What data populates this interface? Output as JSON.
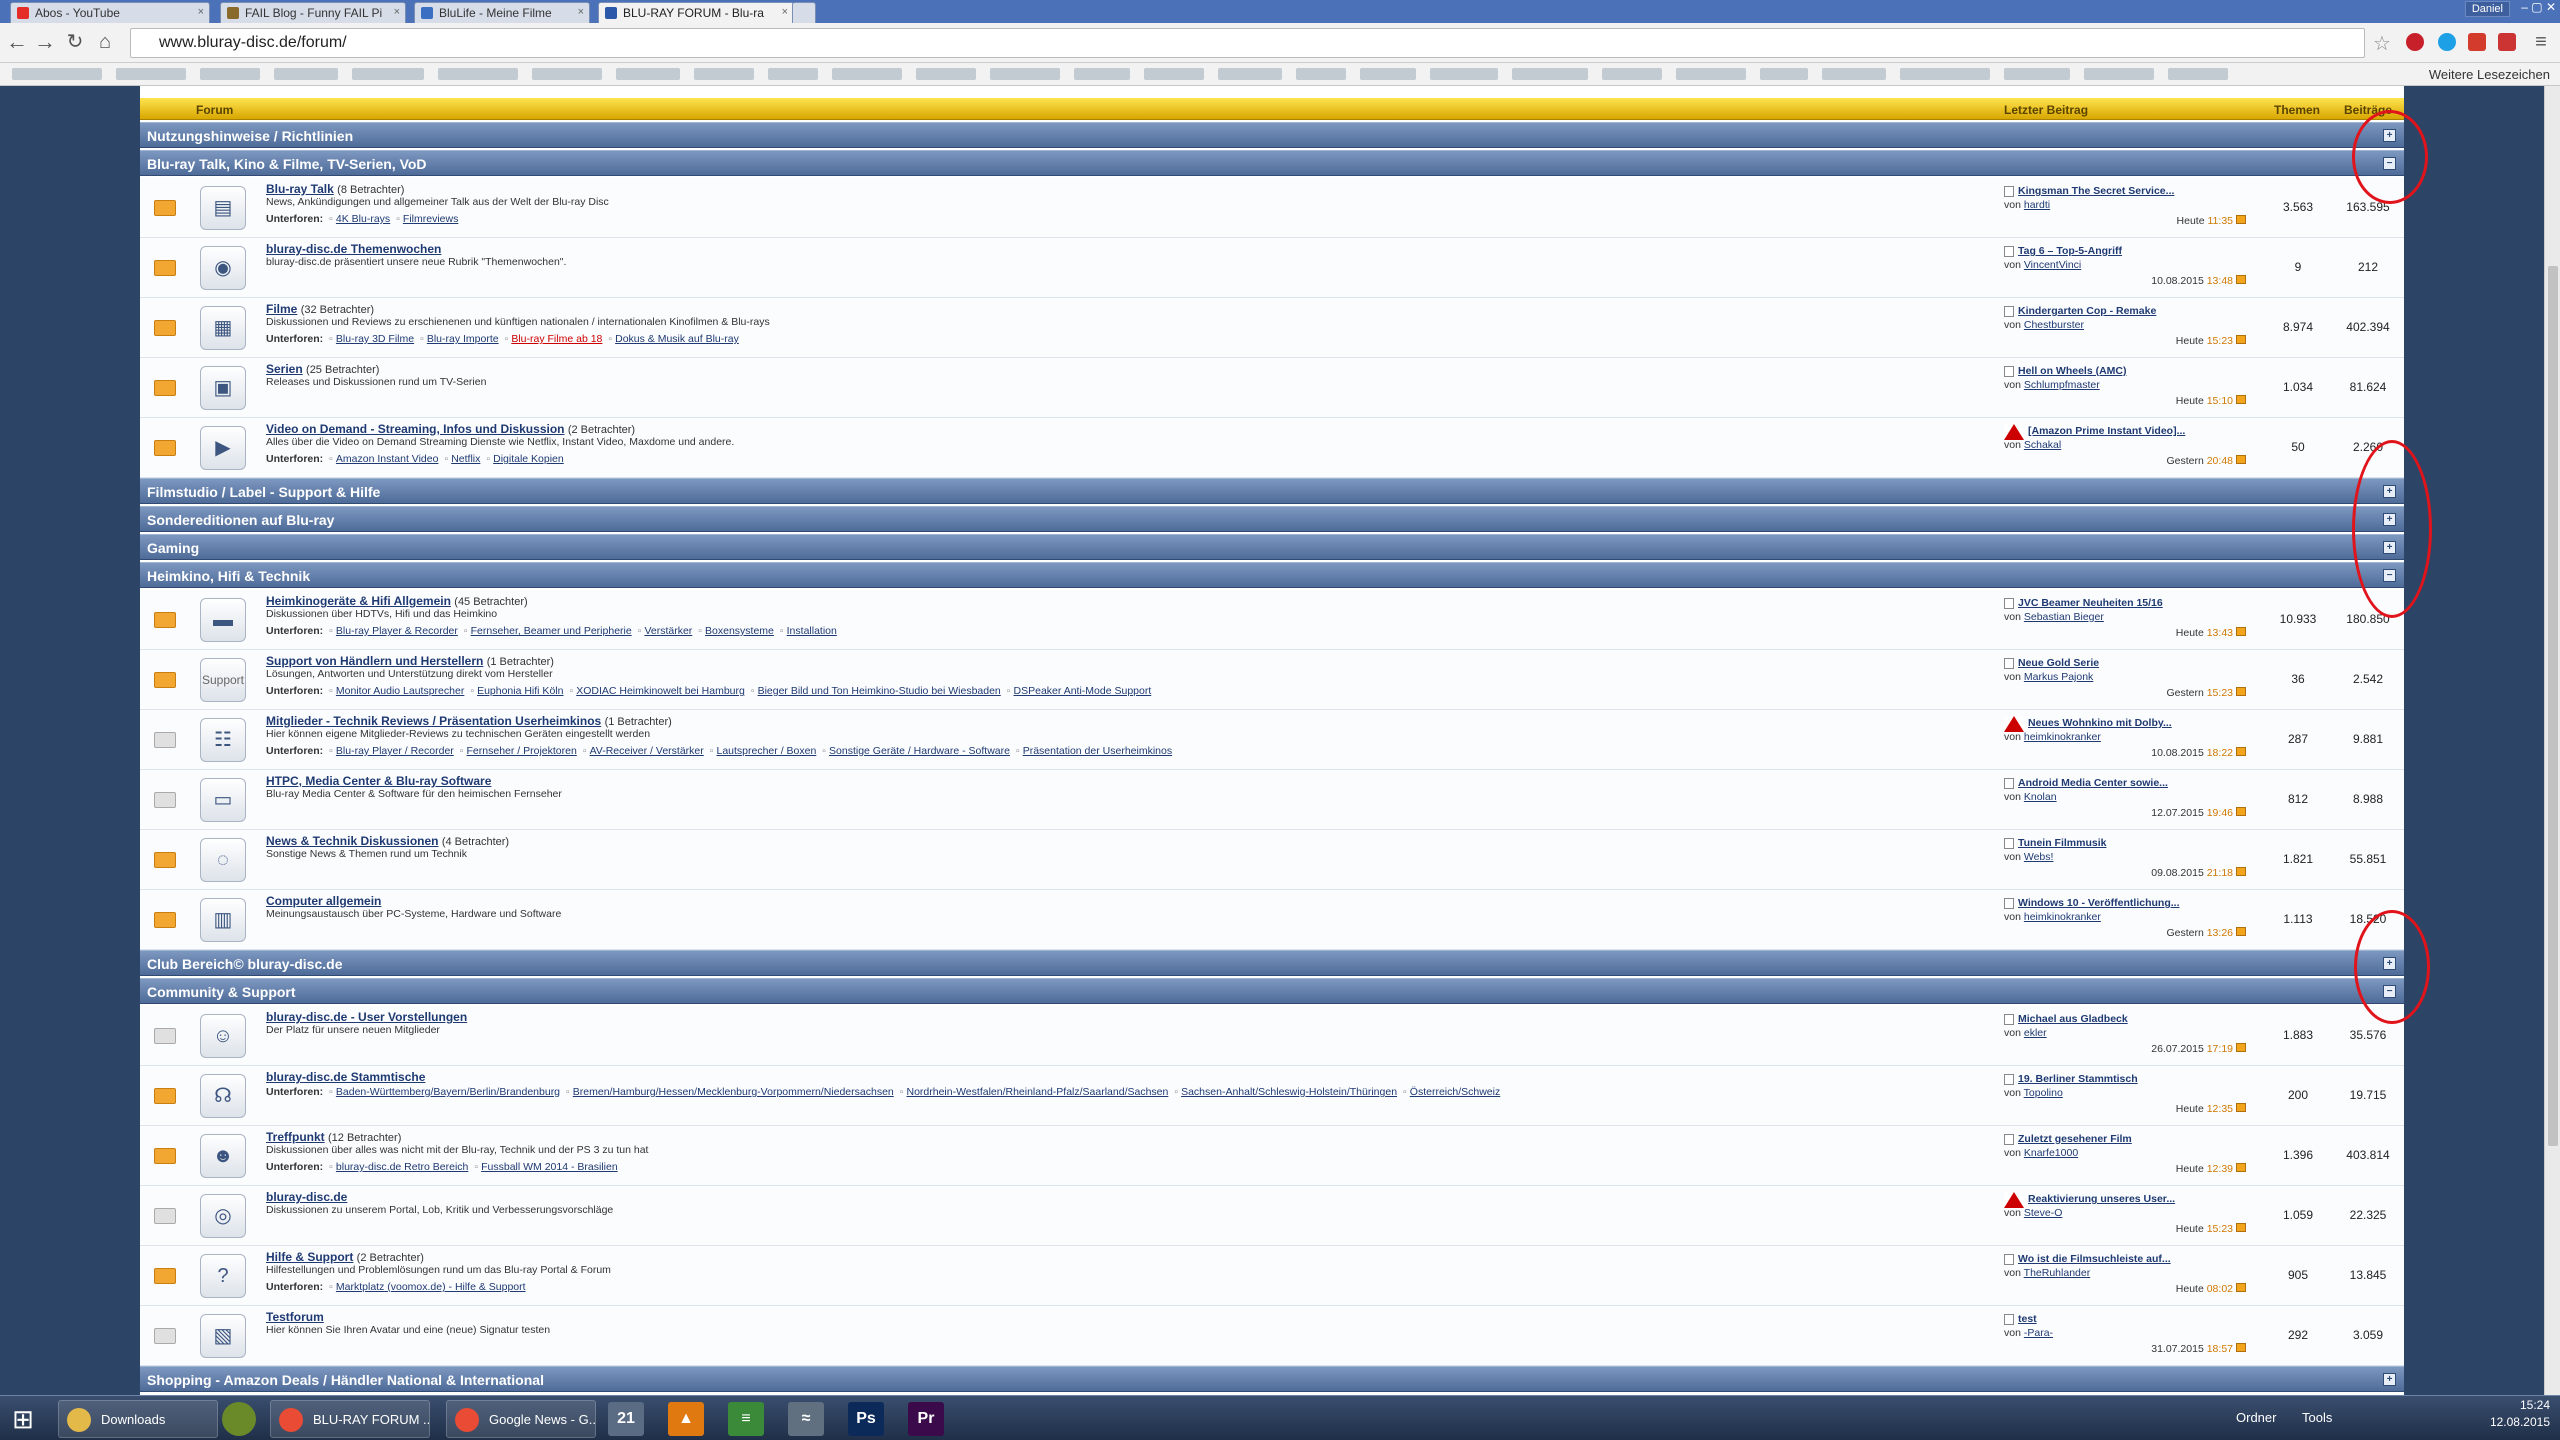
{
  "browser": {
    "tabs": [
      {
        "label": "Abos - YouTube",
        "color": "#e52d27"
      },
      {
        "label": "FAIL Blog - Funny FAIL Pi",
        "color": "#8a6a2b"
      },
      {
        "label": "BluLife - Meine Filme",
        "color": "#3a6fc2"
      },
      {
        "label": "BLU-RAY FORUM - Blu-ra",
        "color": "#2b58a8"
      }
    ],
    "user": "Daniel",
    "url": "www.bluray-disc.de/forum/",
    "more_bookmarks": "Weitere Lesezeichen"
  },
  "forum": {
    "header": {
      "forum": "Forum",
      "last": "Letzter Beitrag",
      "themen": "Themen",
      "beitraege": "Beiträge"
    },
    "sub_label": "Unterforen:",
    "categories": [
      {
        "title": "Nutzungshinweise / Richtlinien",
        "toggle": "+"
      },
      {
        "title": "Blu-ray Talk, Kino & Filme, TV-Serien, VoD",
        "toggle": "−"
      },
      {
        "title": "Filmstudio / Label - Support & Hilfe",
        "toggle": "+"
      },
      {
        "title": "Sondereditionen auf Blu-ray",
        "toggle": "+"
      },
      {
        "title": "Gaming",
        "toggle": "+"
      },
      {
        "title": "Heimkino, Hifi & Technik",
        "toggle": "−"
      },
      {
        "title": "Club Bereich© bluray-disc.de",
        "toggle": "+"
      },
      {
        "title": "Community & Support",
        "toggle": "−"
      },
      {
        "title": "Shopping - Amazon Deals / Händler National & International",
        "toggle": "+"
      }
    ],
    "rows": [
      {
        "title": "Blu-ray Talk",
        "views": "(8 Betrachter)",
        "desc": "News, Ankündigungen und allgemeiner Talk aus der Welt der Blu-ray Disc",
        "subs": [
          "4K Blu-rays",
          "Filmreviews"
        ],
        "last_title": "Kingsman The Secret Service...",
        "last_user": "hardti",
        "last_date": "Heute",
        "last_time": "11:35",
        "themen": "3.563",
        "beitraege": "163.595",
        "icon": "disc-stack-icon",
        "glyph": "▤",
        "warn": false
      },
      {
        "title": "bluray-disc.de Themenwochen",
        "views": "",
        "desc": "bluray-disc.de präsentiert unsere neue Rubrik \"Themenwochen\".",
        "subs": [],
        "last_title": "Tag 6 – Top-5-Angriff",
        "last_user": "VincentVinci",
        "last_date": "10.08.2015",
        "last_time": "13:48",
        "themen": "9",
        "beitraege": "212",
        "icon": "discs-icon",
        "glyph": "◉",
        "warn": false
      },
      {
        "title": "Filme",
        "views": "(32 Betrachter)",
        "desc": "Diskussionen und Reviews zu erschienenen und künftigen nationalen / internationalen Kinofilmen & Blu-rays",
        "subs": [
          "Blu-ray 3D Filme",
          "Blu-ray Importe",
          "Blu-ray Filme ab 18",
          "Dokus & Musik auf Blu-ray"
        ],
        "last_title": "Kindergarten Cop - Remake",
        "last_user": "Chestburster",
        "last_date": "Heute",
        "last_time": "15:23",
        "themen": "8.974",
        "beitraege": "402.394",
        "icon": "film-icon",
        "glyph": "▦",
        "warn": false
      },
      {
        "title": "Serien",
        "views": "(25 Betrachter)",
        "desc": "Releases und Diskussionen rund um TV-Serien",
        "subs": [],
        "last_title": "Hell on Wheels (AMC)",
        "last_user": "Schlumpfmaster",
        "last_date": "Heute",
        "last_time": "15:10",
        "themen": "1.034",
        "beitraege": "81.624",
        "icon": "tv-series-icon",
        "glyph": "▣",
        "warn": false
      },
      {
        "title": "Video on Demand - Streaming, Infos und Diskussion",
        "views": "(2 Betrachter)",
        "desc": "Alles über die Video on Demand Streaming Dienste wie Netflix, Instant Video, Maxdome und andere.",
        "subs": [
          "Amazon Instant Video",
          "Netflix",
          "Digitale Kopien"
        ],
        "last_title": "[Amazon Prime Instant Video]...",
        "last_user": "Schakal",
        "last_date": "Gestern",
        "last_time": "20:48",
        "themen": "50",
        "beitraege": "2.260",
        "icon": "video-on-demand-icon",
        "glyph": "▶",
        "warn": true
      },
      {
        "title": "Heimkinogeräte & Hifi Allgemein",
        "views": "(45 Betrachter)",
        "desc": "Diskussionen über HDTVs, Hifi und das Heimkino",
        "subs": [
          "Blu-ray Player & Recorder",
          "Fernseher, Beamer und Peripherie",
          "Verstärker",
          "Boxensysteme",
          "Installation"
        ],
        "last_title": "JVC Beamer Neuheiten 15/16",
        "last_user": "Sebastian Bieger",
        "last_date": "Heute",
        "last_time": "13:43",
        "themen": "10.933",
        "beitraege": "180.850",
        "icon": "tv-icon",
        "glyph": "▬",
        "warn": false
      },
      {
        "title": "Support von Händlern und Herstellern",
        "views": "(1 Betrachter)",
        "desc": "Lösungen, Antworten und Unterstützung direkt vom Hersteller",
        "subs": [
          "Monitor Audio Lautsprecher",
          "Euphonia Hifi Köln",
          "XODIAC Heimkinowelt bei Hamburg",
          "Bieger Bild und Ton Heimkino-Studio bei Wiesbaden",
          "DSPeaker Anti-Mode Support"
        ],
        "last_title": "Neue Gold Serie",
        "last_user": "Markus Pajonk",
        "last_date": "Gestern",
        "last_time": "15:23",
        "themen": "36",
        "beitraege": "2.542",
        "icon": "support-icon",
        "glyph": "Support",
        "warn": false
      },
      {
        "title": "Mitglieder - Technik Reviews / Präsentation Userheimkinos",
        "views": "(1 Betrachter)",
        "desc": "Hier können eigene Mitglieder-Reviews zu technischen Geräten eingestellt werden",
        "subs": [
          "Blu-ray Player / Recorder",
          "Fernseher / Projektoren",
          "AV-Receiver / Verstärker",
          "Lautsprecher / Boxen",
          "Sonstige Geräte / Hardware - Software",
          "Präsentation der Userheimkinos"
        ],
        "last_title": "Neues Wohnkino mit Dolby...",
        "last_user": "heimkinokranker",
        "last_date": "10.08.2015",
        "last_time": "18:22",
        "themen": "287",
        "beitraege": "9.881",
        "icon": "technik-reviews-icon",
        "glyph": "☷",
        "warn": true
      },
      {
        "title": "HTPC, Media Center & Blu-ray Software",
        "views": "",
        "desc": "Blu-ray Media Center & Software für den heimischen Fernseher",
        "subs": [],
        "last_title": "Android Media Center sowie...",
        "last_user": "Knolan",
        "last_date": "12.07.2015",
        "last_time": "19:46",
        "themen": "812",
        "beitraege": "8.988",
        "icon": "htpc-icon",
        "glyph": "▭",
        "warn": false
      },
      {
        "title": "News & Technik Diskussionen",
        "views": "(4 Betrachter)",
        "desc": "Sonstige News & Themen rund um Technik",
        "subs": [],
        "last_title": "Tunein Filmmusik",
        "last_user": "Webs!",
        "last_date": "09.08.2015",
        "last_time": "21:18",
        "themen": "1.821",
        "beitraege": "55.851",
        "icon": "speech-bubble-icon",
        "glyph": "◌",
        "warn": false
      },
      {
        "title": "Computer allgemein",
        "views": "",
        "desc": "Meinungsaustausch über PC-Systeme, Hardware und Software",
        "subs": [],
        "last_title": "Windows 10 - Veröffentlichung...",
        "last_user": "heimkinokranker",
        "last_date": "Gestern",
        "last_time": "13:26",
        "themen": "1.113",
        "beitraege": "18.520",
        "icon": "computer-icon",
        "glyph": "▥",
        "warn": false
      },
      {
        "title": "bluray-disc.de - User Vorstellungen",
        "views": "",
        "desc": "Der Platz für unsere neuen Mitglieder",
        "subs": [],
        "last_title": "Michael aus Gladbeck",
        "last_user": "ekler",
        "last_date": "26.07.2015",
        "last_time": "17:19",
        "themen": "1.883",
        "beitraege": "35.576",
        "icon": "user-icon",
        "glyph": "☺",
        "warn": false
      },
      {
        "title": "bluray-disc.de Stammtische",
        "views": "",
        "desc": "",
        "subs": [
          "Baden-Württemberg/Bayern/Berlin/Brandenburg",
          "Bremen/Hamburg/Hessen/Mecklenburg-Vorpommern/Niedersachsen",
          "Nordrhein-Westfalen/Rheinland-Pfalz/Saarland/Sachsen",
          "Sachsen-Anhalt/Schleswig-Holstein/Thüringen",
          "Österreich/Schweiz"
        ],
        "last_title": "19. Berliner Stammtisch",
        "last_user": "Topolino",
        "last_date": "Heute",
        "last_time": "12:35",
        "themen": "200",
        "beitraege": "19.715",
        "icon": "stammtisch-icon",
        "glyph": "☊",
        "warn": false
      },
      {
        "title": "Treffpunkt",
        "views": "(12 Betrachter)",
        "desc": "Diskussionen über alles was nicht mit der Blu-ray, Technik und der PS 3 zu tun hat",
        "subs": [
          "bluray-disc.de Retro Bereich",
          "Fussball WM 2014 - Brasilien"
        ],
        "last_title": "Zuletzt gesehener Film",
        "last_user": "Knarfe1000",
        "last_date": "Heute",
        "last_time": "12:39",
        "themen": "1.396",
        "beitraege": "403.814",
        "icon": "treffpunkt-icon",
        "glyph": "☻",
        "warn": false
      },
      {
        "title": "bluray-disc.de",
        "views": "",
        "desc": "Diskussionen zu unserem Portal, Lob, Kritik und Verbesserungsvorschläge",
        "subs": [],
        "last_title": "Reaktivierung unseres User...",
        "last_user": "Steve-O",
        "last_date": "Heute",
        "last_time": "15:23",
        "themen": "1.059",
        "beitraege": "22.325",
        "icon": "bluray-disc-logo-icon",
        "glyph": "◎",
        "warn": true
      },
      {
        "title": "Hilfe & Support",
        "views": "(2 Betrachter)",
        "desc": "Hilfestellungen und Problemlösungen rund um das Blu-ray Portal & Forum",
        "subs": [
          "Marktplatz (voomox.de) - Hilfe & Support"
        ],
        "last_title": "Wo ist die Filmsuchleiste auf...",
        "last_user": "TheRuhlander",
        "last_date": "Heute",
        "last_time": "08:02",
        "themen": "905",
        "beitraege": "13.845",
        "icon": "help-icon",
        "glyph": "?",
        "warn": false
      },
      {
        "title": "Testforum",
        "views": "",
        "desc": "Hier können Sie Ihren Avatar und eine (neue) Signatur testen",
        "subs": [],
        "last_title": "test",
        "last_user": "-Para-",
        "last_date": "31.07.2015",
        "last_time": "18:57",
        "themen": "292",
        "beitraege": "3.059",
        "icon": "test-icon",
        "glyph": "▧",
        "warn": false
      }
    ],
    "by_label": "von"
  },
  "taskbar": {
    "items": [
      {
        "label": "Downloads",
        "color": "#e3b94a"
      },
      {
        "label": "BLU-RAY FORUM ...",
        "color": "#e94b35"
      },
      {
        "label": "Google News - G...",
        "color": "#e94b35"
      }
    ],
    "apps": [
      {
        "label": "21",
        "color": "#5a6b84"
      },
      {
        "label": "▲",
        "color": "#e07a10"
      },
      {
        "label": "≡",
        "color": "#3a8a3a"
      },
      {
        "label": "≈",
        "color": "#607080"
      },
      {
        "label": "Ps",
        "color": "#0b2a5a"
      },
      {
        "label": "Pr",
        "color": "#3a0a4a"
      }
    ],
    "ordner": "Ordner",
    "tools": "Tools",
    "time": "15:24",
    "date": "12.08.2015"
  }
}
